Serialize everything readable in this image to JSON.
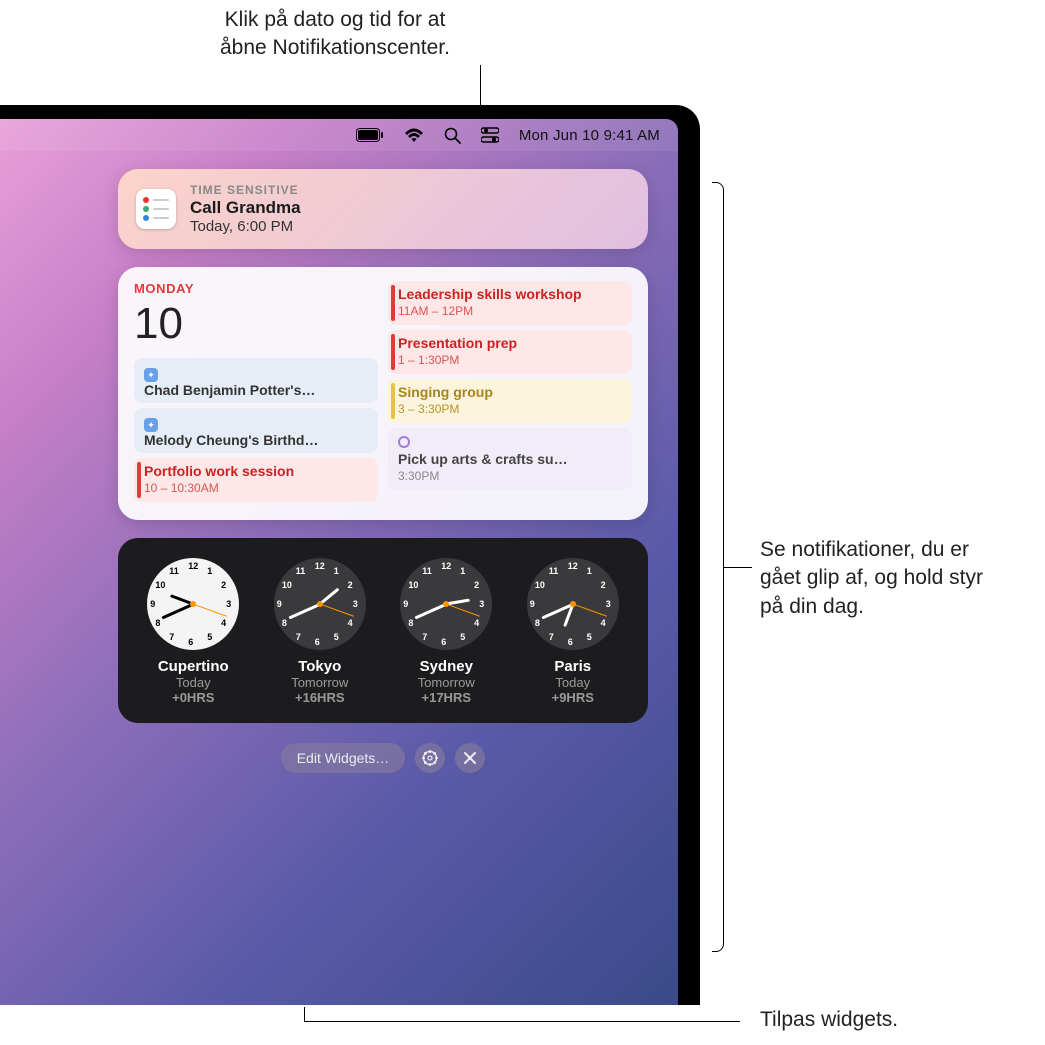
{
  "callouts": {
    "top": "Klik på dato og tid for at\nåbne Notifikationscenter.",
    "right": "Se notifikationer, du er\ngået glip af, og hold styr\npå din dag.",
    "bottom": "Tilpas widgets."
  },
  "menubar": {
    "datetime": "Mon Jun 10  9:41 AM"
  },
  "notification": {
    "tag": "TIME SENSITIVE",
    "title": "Call Grandma",
    "subtitle": "Today, 6:00 PM"
  },
  "calendar": {
    "day_label": "MONDAY",
    "day_num": "10",
    "left_events": [
      {
        "type": "blue",
        "title": "Chad Benjamin Potter's…"
      },
      {
        "type": "blue",
        "title": "Melody Cheung's Birthd…"
      },
      {
        "type": "red",
        "title": "Portfolio work session",
        "time": "10 – 10:30AM"
      }
    ],
    "right_events": [
      {
        "type": "red",
        "title": "Leadership skills workshop",
        "time": "11AM – 12PM"
      },
      {
        "type": "red",
        "title": "Presentation prep",
        "time": "1 – 1:30PM"
      },
      {
        "type": "yellow",
        "title": "Singing group",
        "time": "3 – 3:30PM"
      },
      {
        "type": "purple",
        "title": "Pick up arts & crafts su…",
        "time": "3:30PM"
      }
    ]
  },
  "clocks": [
    {
      "city": "Cupertino",
      "day": "Today",
      "offset": "+0HRS",
      "face": "light",
      "h": 9,
      "m": 41
    },
    {
      "city": "Tokyo",
      "day": "Tomorrow",
      "offset": "+16HRS",
      "face": "dark",
      "h": 1,
      "m": 41
    },
    {
      "city": "Sydney",
      "day": "Tomorrow",
      "offset": "+17HRS",
      "face": "dark",
      "h": 2,
      "m": 41
    },
    {
      "city": "Paris",
      "day": "Today",
      "offset": "+9HRS",
      "face": "dark",
      "h": 18,
      "m": 41
    }
  ],
  "edit": {
    "label": "Edit Widgets…"
  }
}
